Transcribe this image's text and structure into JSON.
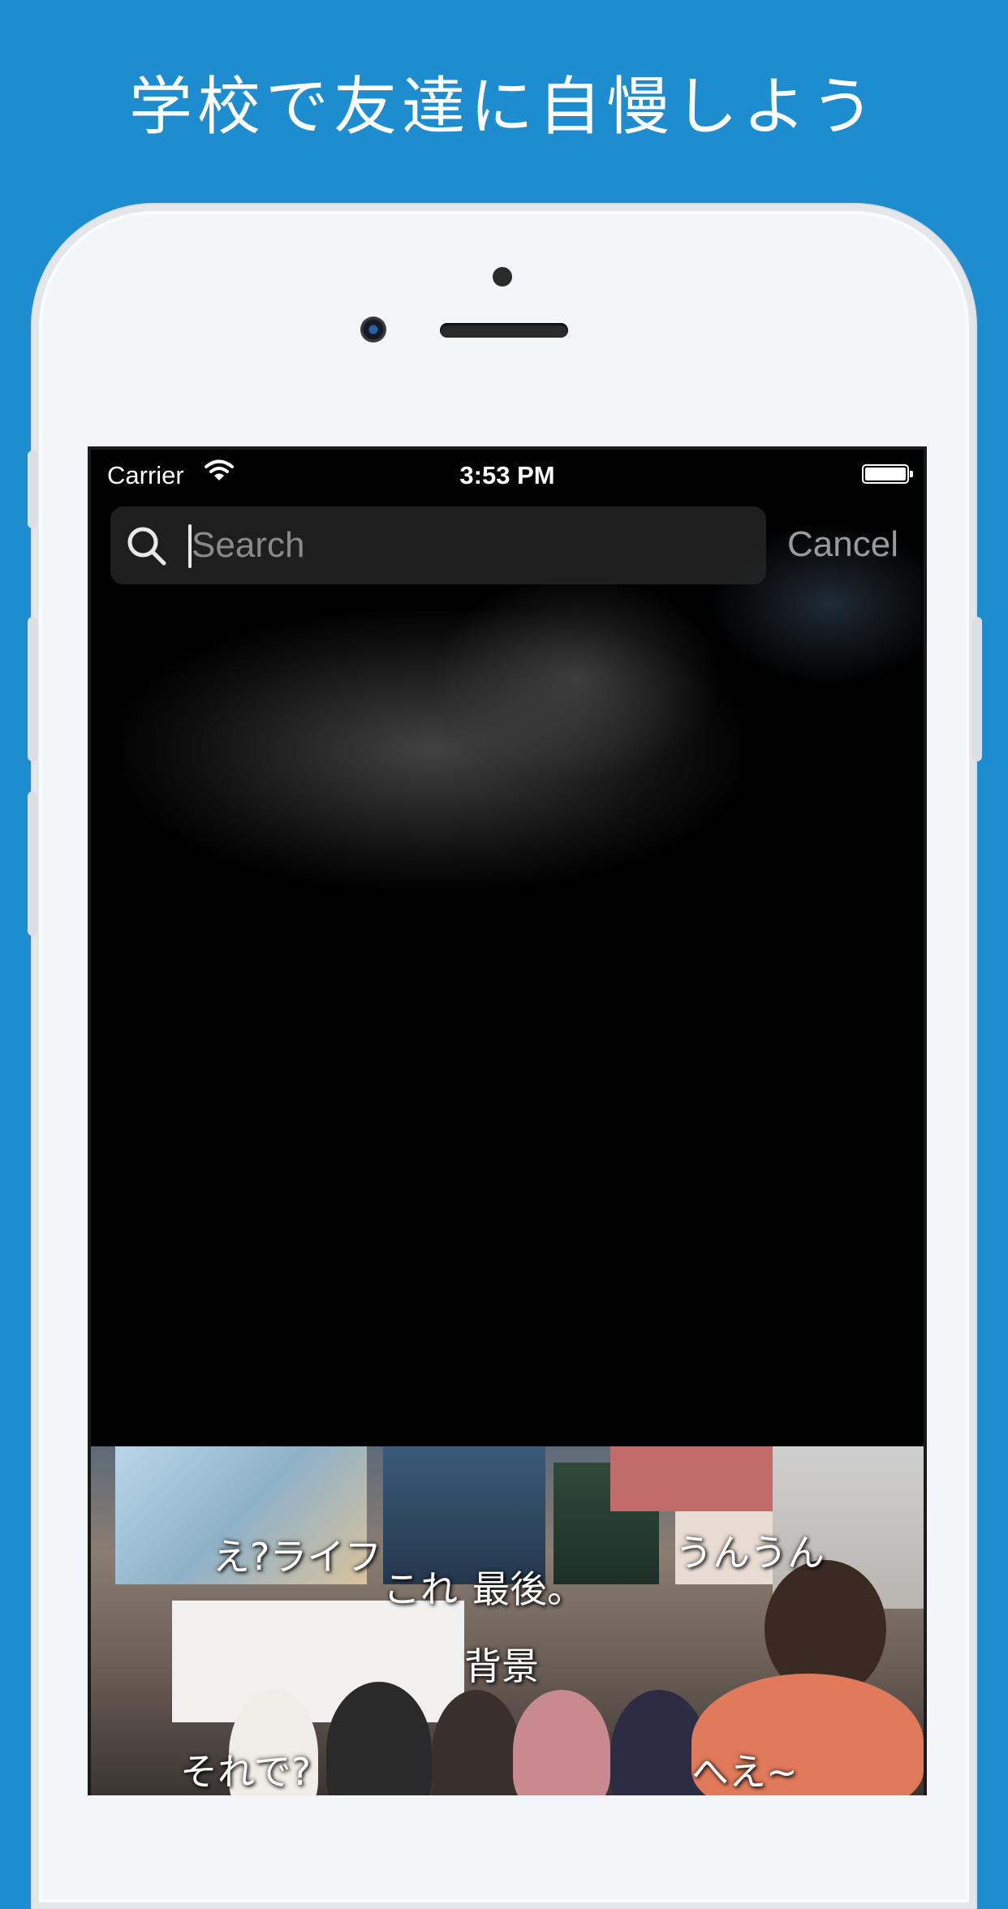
{
  "headline": "学校で友達に自慢しよう",
  "status_bar": {
    "carrier": "Carrier",
    "time": "3:53 PM"
  },
  "search": {
    "placeholder": "Search",
    "cancel_label": "Cancel"
  },
  "video_subtitles": [
    "え?ライフ",
    "これ",
    "最後。",
    "うんうん",
    "背景",
    "それで?",
    "へえ~"
  ],
  "colors": {
    "background": "#1e8dd0",
    "screen": "#000000",
    "text": "#ffffff"
  }
}
